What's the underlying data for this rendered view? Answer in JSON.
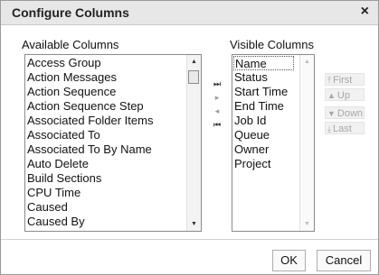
{
  "dialog": {
    "title": "Configure Columns",
    "close_glyph": "×"
  },
  "available": {
    "label": "Available Columns",
    "items": [
      "Access Group",
      "Action Messages",
      "Action Sequence",
      "Action Sequence Step",
      "Associated Folder Items",
      "Associated To",
      "Associated To By Name",
      "Auto Delete",
      "Build Sections",
      "CPU Time",
      "Caused",
      "Caused By"
    ]
  },
  "visible": {
    "label": "Visible Columns",
    "items": [
      "Name",
      "Status",
      "Start Time",
      "End Time",
      "Job Id",
      "Queue",
      "Owner",
      "Project"
    ],
    "selected": "Name"
  },
  "move_buttons": {
    "add_all": "⏭",
    "add": "▸",
    "remove": "◂",
    "remove_all": "⏮"
  },
  "order_buttons": {
    "first": "First",
    "up": "Up",
    "down": "Down",
    "last": "Last"
  },
  "footer": {
    "ok": "OK",
    "cancel": "Cancel"
  }
}
